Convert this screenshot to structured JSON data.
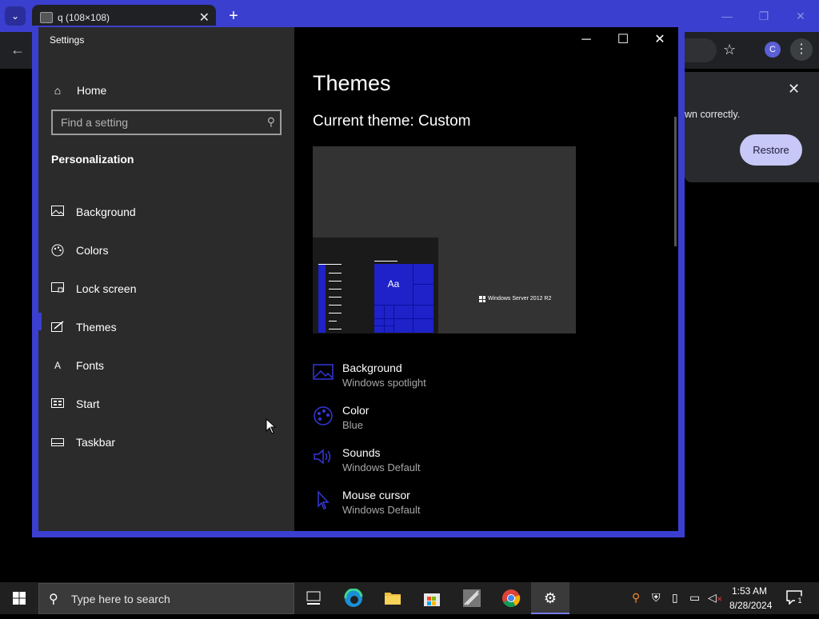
{
  "chrome": {
    "tab_title": "q (108×108)",
    "restore_message": "wn correctly.",
    "restore_button": "Restore",
    "profile_initial": "C"
  },
  "settings": {
    "window_title": "Settings",
    "home_label": "Home",
    "search_placeholder": "Find a setting",
    "section_heading": "Personalization",
    "nav": [
      {
        "label": "Background",
        "icon": "image-icon"
      },
      {
        "label": "Colors",
        "icon": "palette-icon"
      },
      {
        "label": "Lock screen",
        "icon": "lock-screen-icon"
      },
      {
        "label": "Themes",
        "icon": "themes-icon",
        "selected": true
      },
      {
        "label": "Fonts",
        "icon": "fonts-icon"
      },
      {
        "label": "Start",
        "icon": "start-icon"
      },
      {
        "label": "Taskbar",
        "icon": "taskbar-icon"
      }
    ],
    "page_title": "Themes",
    "current_theme": "Current theme: Custom",
    "preview": {
      "tile_label": "Aa",
      "os_label": "Windows Server 2012 R2"
    },
    "theme_settings": [
      {
        "name": "Background",
        "value": "Windows spotlight",
        "icon": "image-icon"
      },
      {
        "name": "Color",
        "value": "Blue",
        "icon": "palette-icon"
      },
      {
        "name": "Sounds",
        "value": "Windows Default",
        "icon": "speaker-icon"
      },
      {
        "name": "Mouse cursor",
        "value": "Windows Default",
        "icon": "cursor-icon"
      }
    ]
  },
  "taskbar": {
    "search_placeholder": "Type here to search",
    "time": "1:53 AM",
    "date": "8/28/2024",
    "notification_count": "1"
  },
  "colors": {
    "accent": "#3b3fcf",
    "icon_blue": "#3437d8"
  }
}
